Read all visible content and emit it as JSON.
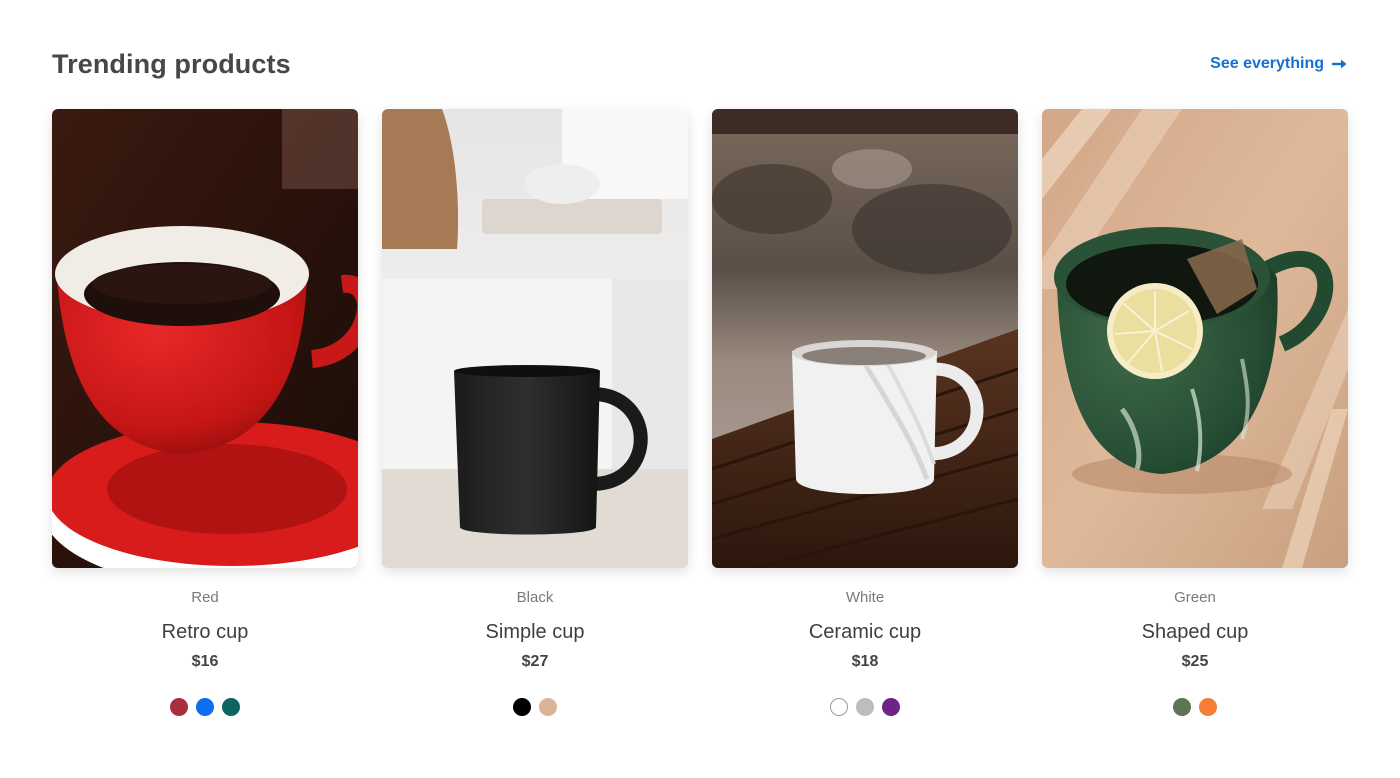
{
  "section": {
    "title": "Trending products",
    "see_all_label": "See everything"
  },
  "products": [
    {
      "color_label": "Red",
      "name": "Retro cup",
      "price": "$16",
      "image": "red-coffee-cup-photo",
      "swatches": [
        "#a8303e",
        "#0d6ef0",
        "#0e6460"
      ]
    },
    {
      "color_label": "Black",
      "name": "Simple cup",
      "price": "$27",
      "image": "black-mug-photo",
      "swatches": [
        "#000000",
        "#dcb298"
      ]
    },
    {
      "color_label": "White",
      "name": "Ceramic cup",
      "price": "$18",
      "image": "white-mug-photo",
      "swatches": [
        "#ffffff",
        "#bdbdbd",
        "#6e2486"
      ]
    },
    {
      "color_label": "Green",
      "name": "Shaped cup",
      "price": "$25",
      "image": "green-tea-cup-photo",
      "swatches": [
        "#5b7555",
        "#f67e34"
      ]
    }
  ],
  "colors": {
    "accent": "#1570d4",
    "title": "#474747",
    "muted": "#7a7a7a"
  }
}
